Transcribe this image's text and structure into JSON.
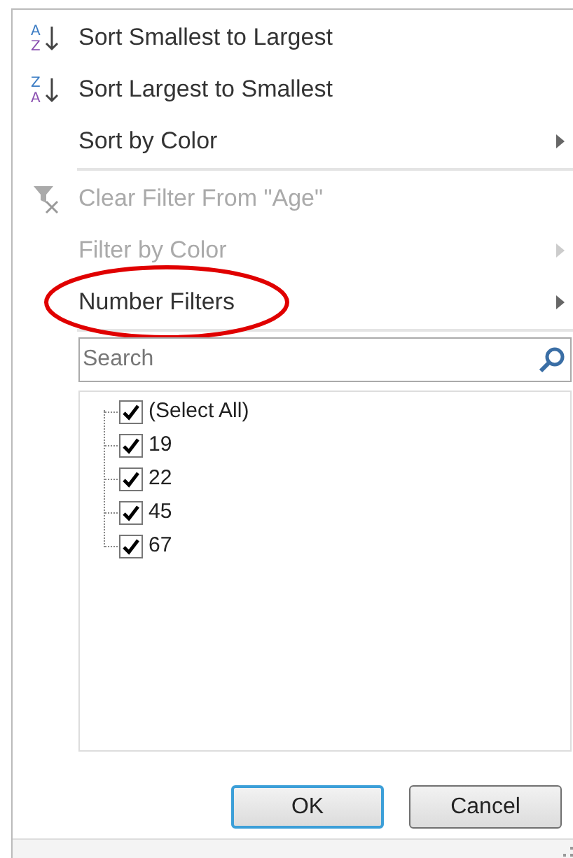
{
  "menu_items": [
    {
      "kind": "sort",
      "icon_text": [
        "A",
        "Z"
      ],
      "label": "Sort Smallest to Largest",
      "disabled": false,
      "submenu": false
    },
    {
      "kind": "sort",
      "icon_text": [
        "Z",
        "A"
      ],
      "label": "Sort Largest to Smallest",
      "disabled": false,
      "submenu": false
    },
    {
      "kind": "plain",
      "label": "Sort by Color",
      "disabled": false,
      "submenu": true
    },
    {
      "kind": "separator"
    },
    {
      "kind": "clear",
      "label": "Clear Filter From \"Age\"",
      "disabled": true,
      "submenu": false
    },
    {
      "kind": "plain",
      "label": "Filter by Color",
      "disabled": true,
      "submenu": true
    },
    {
      "kind": "plain",
      "label": "Number Filters",
      "disabled": false,
      "submenu": true,
      "circled": true
    },
    {
      "kind": "separator"
    }
  ],
  "search": {
    "placeholder": "Search"
  },
  "values": [
    {
      "label": "(Select All)",
      "checked": true
    },
    {
      "label": "19",
      "checked": true
    },
    {
      "label": "22",
      "checked": true
    },
    {
      "label": "45",
      "checked": true
    },
    {
      "label": "67",
      "checked": true
    }
  ],
  "buttons": [
    {
      "label": "OK",
      "default": true
    },
    {
      "label": "Cancel",
      "default": false
    }
  ]
}
